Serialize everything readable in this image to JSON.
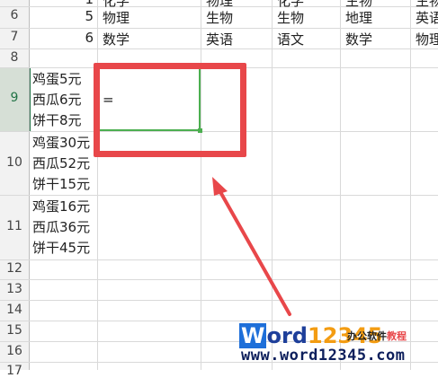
{
  "rows": {
    "r5": {
      "num": "",
      "cells": [
        "1",
        "化学",
        "物理",
        "化学",
        "生物",
        "生物"
      ]
    },
    "r6": {
      "num": "6",
      "cells": [
        "5",
        "物理",
        "生物",
        "生物",
        "地理",
        "英语"
      ]
    },
    "r7": {
      "num": "7",
      "cells": [
        "6",
        "数学",
        "英语",
        "语文",
        "数学",
        "物理"
      ]
    },
    "r8": {
      "num": "8"
    },
    "r9": {
      "num": "9",
      "items": [
        "鸡蛋5元",
        "西瓜6元",
        "饼干8元"
      ]
    },
    "r10": {
      "num": "10",
      "items": [
        "鸡蛋30元",
        "西瓜52元",
        "饼干15元"
      ]
    },
    "r11": {
      "num": "11",
      "items": [
        "鸡蛋16元",
        "西瓜36元",
        "饼干45元"
      ]
    },
    "r12": {
      "num": "12"
    },
    "r13": {
      "num": "13"
    },
    "r14": {
      "num": "14"
    },
    "r15": {
      "num": "15"
    },
    "r16": {
      "num": "16"
    },
    "r17": {
      "num": "17"
    }
  },
  "active_cell": {
    "formula": "="
  },
  "watermark": {
    "brand_w": "W",
    "brand_ord": "ord",
    "brand_num": "12345",
    "tag_normal": "办公软件",
    "tag_accent": "教程",
    "url": "www.word12345.com"
  },
  "colors": {
    "selection": "#4caf50",
    "highlight": "#e8474a",
    "grid": "#d9d9d9"
  }
}
